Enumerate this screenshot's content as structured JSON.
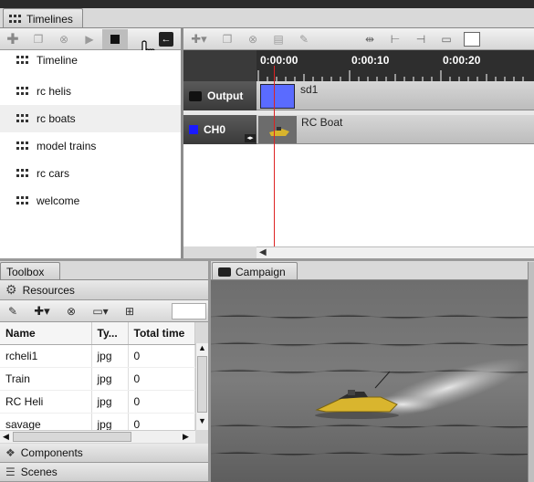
{
  "timelines_tab": {
    "label": "Timelines"
  },
  "timeline_list": {
    "items": [
      {
        "label": "Timeline"
      },
      {
        "label": "rc helis"
      },
      {
        "label": "rc boats"
      },
      {
        "label": "model trains"
      },
      {
        "label": "rc cars"
      },
      {
        "label": "welcome"
      }
    ]
  },
  "ruler": {
    "ticks": [
      "0:00:00",
      "0:00:10",
      "0:00:20"
    ]
  },
  "tracks": [
    {
      "name": "Output",
      "clip": "sd1",
      "clip_color": "#5a6bff"
    },
    {
      "name": "CH0",
      "clip": "RC Boat",
      "dot_color": "#1a1aff"
    }
  ],
  "toolbox": {
    "tab_label": "Toolbox",
    "resources_label": "Resources",
    "columns": [
      "Name",
      "Ty...",
      "Total time"
    ],
    "rows": [
      [
        "rcheli1",
        "jpg",
        "0"
      ],
      [
        "Train",
        "jpg",
        "0"
      ],
      [
        "RC Heli",
        "jpg",
        "0"
      ],
      [
        "savage",
        "jpg",
        "0"
      ]
    ],
    "components_label": "Components",
    "scenes_label": "Scenes"
  },
  "campaign": {
    "tab_label": "Campaign"
  }
}
